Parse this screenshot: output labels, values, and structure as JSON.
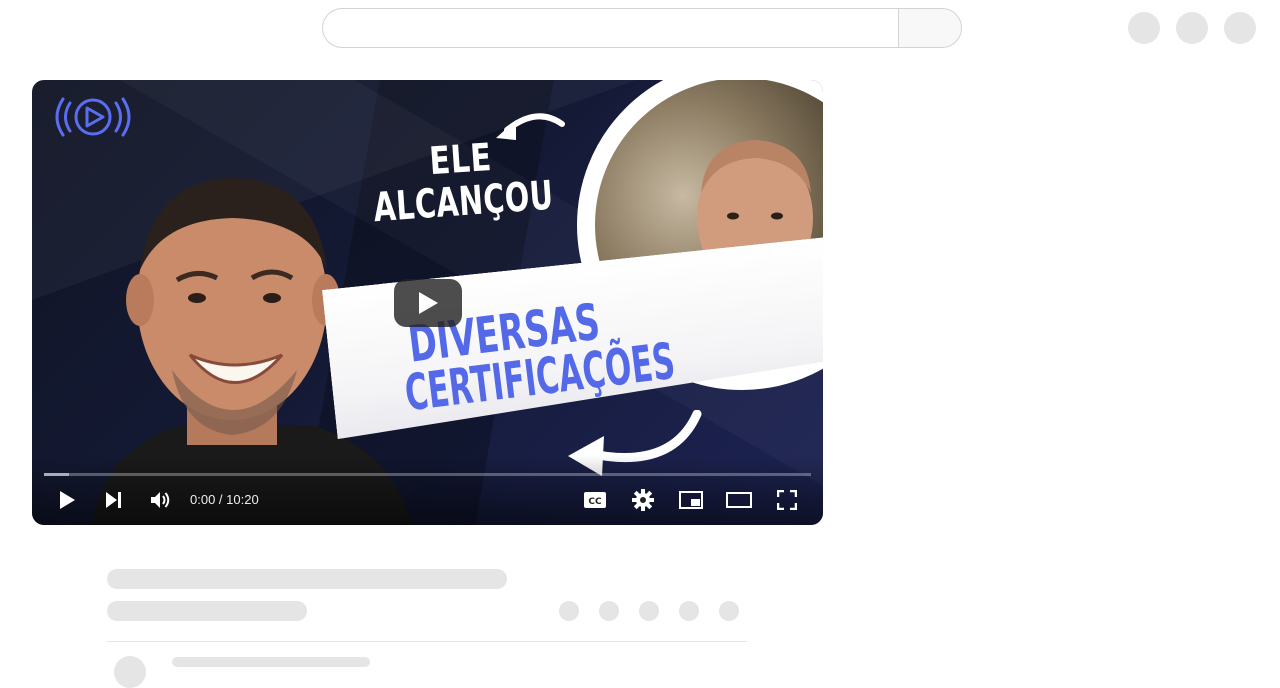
{
  "search": {
    "placeholder": ""
  },
  "video": {
    "thumbnail": {
      "headline_line1": "ELE",
      "headline_line2": "ALCANÇOU",
      "highlight_line1": "DIVERSAS",
      "highlight_line2": "CERTIFICAÇÕES",
      "highlight_color": "#5469e8"
    },
    "controls": {
      "current_time": "0:00",
      "duration": "10:20",
      "time_display": "0:00 / 10:20",
      "buffered_fraction": 0.033
    }
  },
  "icons": {
    "brand": "play-broadcast-icon",
    "play": "play-icon",
    "next": "next-icon",
    "volume": "volume-icon",
    "captions": "cc-icon",
    "settings": "gear-icon",
    "miniplayer": "miniplayer-icon",
    "theater": "theater-mode-icon",
    "fullscreen": "fullscreen-icon"
  }
}
